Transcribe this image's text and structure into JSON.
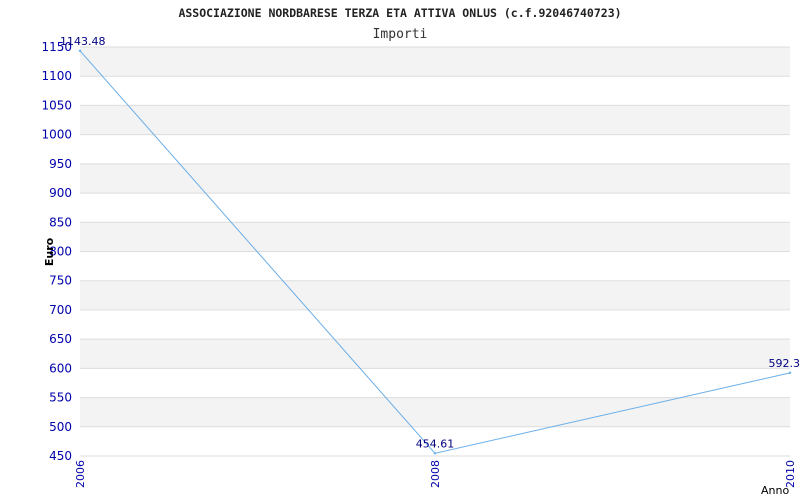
{
  "chart_data": {
    "type": "line",
    "title": "ASSOCIAZIONE NORDBARESE TERZA ETA ATTIVA ONLUS (c.f.92046740723)",
    "subtitle": "Importi",
    "xlabel": "Anno",
    "ylabel": "Euro",
    "x": [
      "2006",
      "2008",
      "2010"
    ],
    "series": [
      {
        "values": [
          1143.48,
          454.61,
          592.3
        ],
        "labels": [
          "1143.48",
          "454.61",
          "592.3"
        ]
      }
    ],
    "ylim": [
      450,
      1150
    ],
    "yticks": [
      450,
      500,
      550,
      600,
      650,
      700,
      750,
      800,
      850,
      900,
      950,
      1000,
      1050,
      1100,
      1150
    ],
    "grid": true,
    "legend": "none"
  },
  "colors": {
    "line": "#6aaee8",
    "band": "#f3f3f3",
    "axis_text": "#0000aa",
    "label_text": "#000080",
    "grid": "#dddddd"
  }
}
